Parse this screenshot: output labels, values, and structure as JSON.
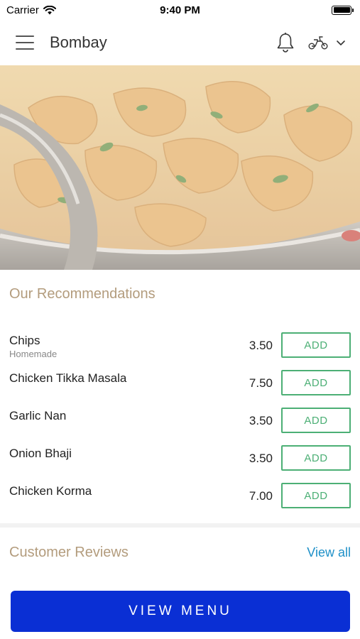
{
  "status_bar": {
    "carrier": "Carrier",
    "time": "9:40 PM"
  },
  "header": {
    "title": "Bombay",
    "icons": [
      "menu-icon",
      "bell-icon",
      "scooter-icon",
      "chevron-down-icon"
    ]
  },
  "hero": {
    "image": "chicken curry dish in metal bowl"
  },
  "recommendations": {
    "title": "Our Recommendations",
    "items": [
      {
        "name": "Chips",
        "subtitle": "Homemade",
        "price": "3.50",
        "add_label": "ADD"
      },
      {
        "name": "Chicken Tikka Masala",
        "subtitle": "",
        "price": "7.50",
        "add_label": "ADD"
      },
      {
        "name": "Garlic Nan",
        "subtitle": "",
        "price": "3.50",
        "add_label": "ADD"
      },
      {
        "name": "Onion Bhaji",
        "subtitle": "",
        "price": "3.50",
        "add_label": "ADD"
      },
      {
        "name": "Chicken Korma",
        "subtitle": "",
        "price": "7.00",
        "add_label": "ADD"
      }
    ]
  },
  "reviews": {
    "title": "Customer Reviews",
    "view_all": "View all"
  },
  "footer": {
    "view_menu_label": "VIEW MENU"
  },
  "colors": {
    "accent_green": "#4caf75",
    "section_title": "#b39c7d",
    "link_blue": "#1e90c8",
    "primary_button": "#0a2fd4"
  }
}
